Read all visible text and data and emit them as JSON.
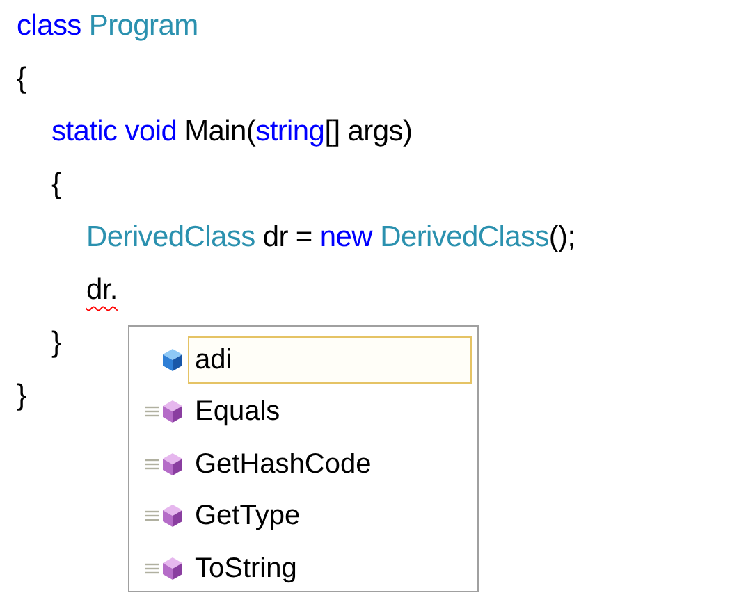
{
  "code": {
    "lines": [
      {
        "tokens": [
          {
            "text": "class",
            "kind": "keyword"
          },
          {
            "text": " Program",
            "kind": "type"
          }
        ]
      },
      {
        "tokens": [
          {
            "text": "{",
            "kind": "plain"
          }
        ],
        "children": [
          {
            "tokens": [
              {
                "text": "static",
                "kind": "keyword"
              },
              {
                "text": " void",
                "kind": "keyword"
              },
              {
                "text": " Main(",
                "kind": "plain"
              },
              {
                "text": "string",
                "kind": "keyword"
              },
              {
                "text": "[] args)",
                "kind": "plain"
              }
            ]
          },
          {
            "tokens": [
              {
                "text": "{",
                "kind": "plain"
              }
            ],
            "children": [
              {
                "tokens": [
                  {
                    "text": "DerivedClass",
                    "kind": "type"
                  },
                  {
                    "text": " dr = ",
                    "kind": "plain"
                  },
                  {
                    "text": "new",
                    "kind": "keyword"
                  },
                  {
                    "text": " DerivedClass",
                    "kind": "type"
                  },
                  {
                    "text": "();",
                    "kind": "plain"
                  }
                ]
              },
              {
                "tokens": [
                  {
                    "text": "dr.",
                    "kind": "plain",
                    "error": true
                  }
                ]
              }
            ]
          },
          {
            "tokens": [
              {
                "text": "}",
                "kind": "plain"
              }
            ]
          }
        ]
      },
      {
        "tokens": [
          {
            "text": "}",
            "kind": "plain"
          }
        ]
      }
    ]
  },
  "completion_list": {
    "items": [
      {
        "label": "adi",
        "kind": "field",
        "selected": true
      },
      {
        "label": "Equals",
        "kind": "method",
        "selected": false
      },
      {
        "label": "GetHashCode",
        "kind": "method",
        "selected": false
      },
      {
        "label": "GetType",
        "kind": "method",
        "selected": false
      },
      {
        "label": "ToString",
        "kind": "method",
        "selected": false
      }
    ]
  }
}
